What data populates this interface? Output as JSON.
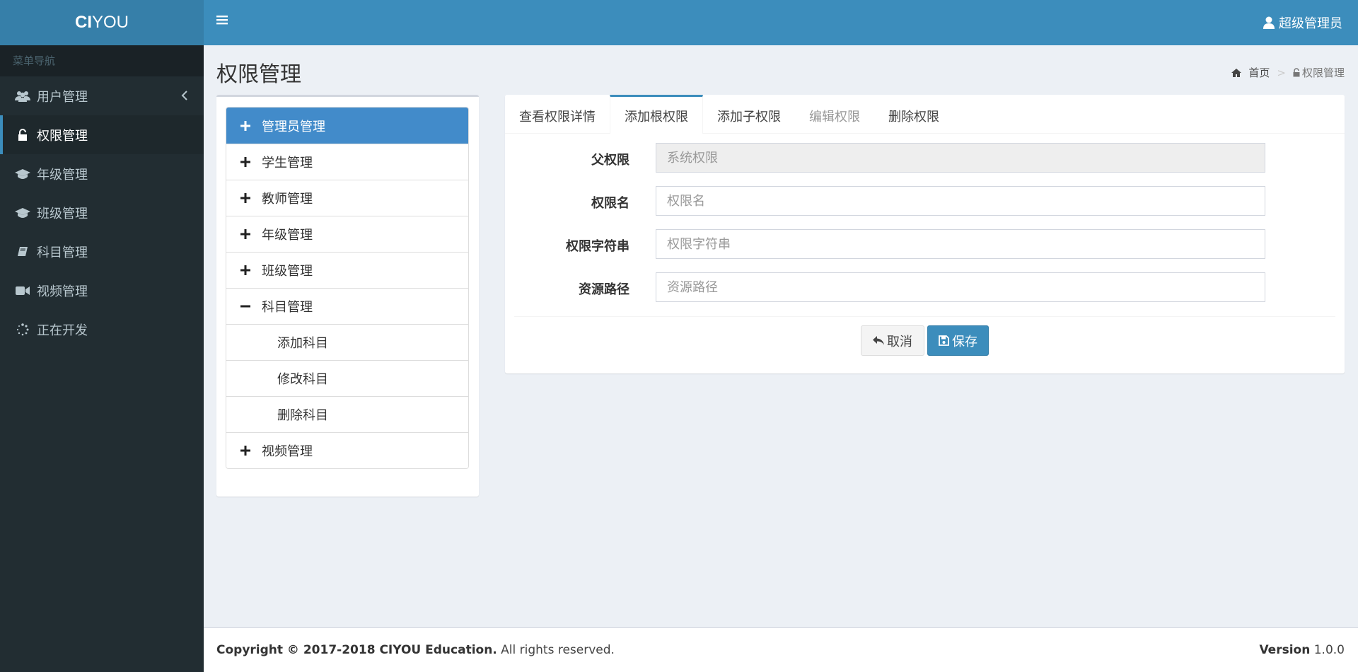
{
  "brand": {
    "bold": "CI",
    "rest": "YOU"
  },
  "sidebar": {
    "header": "菜单导航",
    "items": [
      {
        "label": "用户管理",
        "icon": "users-icon"
      },
      {
        "label": "权限管理",
        "icon": "unlock-icon"
      },
      {
        "label": "年级管理",
        "icon": "graduation-cap-icon"
      },
      {
        "label": "班级管理",
        "icon": "graduation-cap-icon"
      },
      {
        "label": "科目管理",
        "icon": "book-icon"
      },
      {
        "label": "视频管理",
        "icon": "video-camera-icon"
      },
      {
        "label": "正在开发",
        "icon": "spinner-icon"
      }
    ]
  },
  "header": {
    "user": "超级管理员"
  },
  "content": {
    "title": "权限管理",
    "breadcrumb": {
      "home": "首页",
      "current": "权限管理"
    }
  },
  "tree": {
    "items": [
      {
        "label": "管理员管理",
        "sign": "+"
      },
      {
        "label": "学生管理",
        "sign": "+"
      },
      {
        "label": "教师管理",
        "sign": "+"
      },
      {
        "label": "年级管理",
        "sign": "+"
      },
      {
        "label": "班级管理",
        "sign": "+"
      },
      {
        "label": "科目管理",
        "sign": "−"
      },
      {
        "label": "添加科目"
      },
      {
        "label": "修改科目"
      },
      {
        "label": "删除科目"
      },
      {
        "label": "视频管理",
        "sign": "+"
      }
    ]
  },
  "form": {
    "tabs": [
      "查看权限详情",
      "添加根权限",
      "添加子权限",
      "编辑权限",
      "删除权限"
    ],
    "fields": {
      "parent": {
        "label": "父权限",
        "placeholder": "系统权限"
      },
      "name": {
        "label": "权限名",
        "placeholder": "权限名"
      },
      "code": {
        "label": "权限字符串",
        "placeholder": "权限字符串"
      },
      "path": {
        "label": "资源路径",
        "placeholder": "资源路径"
      }
    },
    "cancel": "取消",
    "save": "保存"
  },
  "footer": {
    "copyright": "Copyright © 2017-2018 CIYOU Education.",
    "rights": " All rights reserved.",
    "version_label": "Version",
    "version": " 1.0.0"
  },
  "colors": {
    "primary": "#3c8dbc",
    "sidebar": "#222d32",
    "tree_active": "#428bca"
  }
}
